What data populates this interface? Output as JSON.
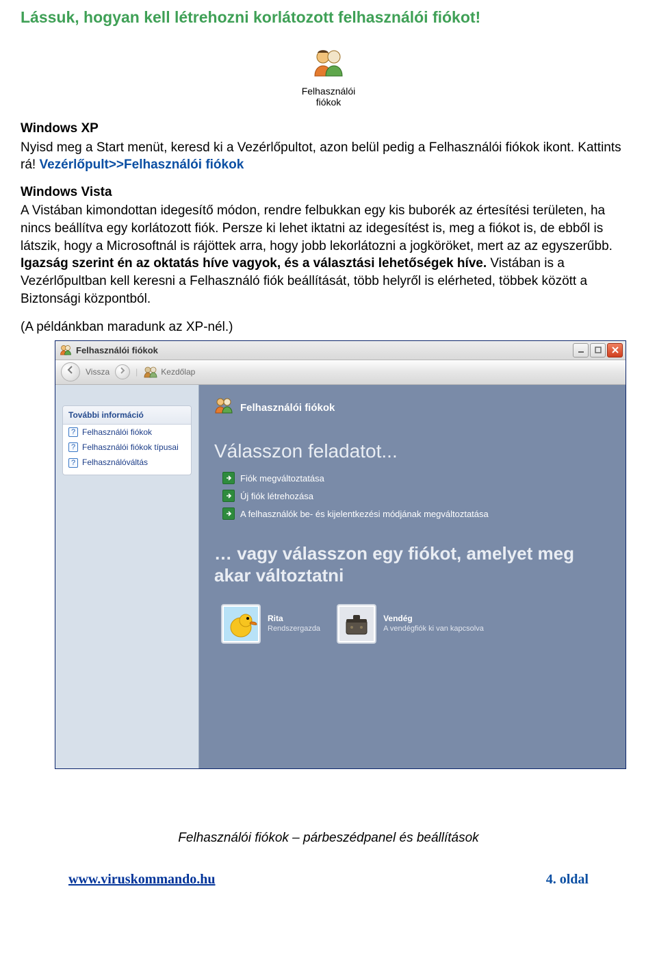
{
  "heading": "Lássuk, hogyan kell létrehozni korlátozott felhasználói fiókot!",
  "center_icon_caption_l1": "Felhasználói",
  "center_icon_caption_l2": "fiókok",
  "xp_heading": "Windows XP",
  "xp_text_pre": "Nyisd meg a Start menüt, keresd ki a Vezérlőpultot, azon belül pedig a Felhasználói fiókok ikont. Kattints rá!",
  "xp_link": "Vezérlőpult>>Felhasználói fiókok",
  "vista_heading": "Windows Vista",
  "vista_para_a": "A Vistában kimondottan idegesítő módon, rendre felbukkan egy kis buborék az értesítési területen, ha nincs  beállítva egy korlátozott fiók. Persze ki lehet iktatni az idegesítést is, meg a fiókot is, de ebből is látszik, hogy a Microsoftnál is rájöttek arra, hogy jobb lekorlátozni a jogköröket, mert az az egyszerűbb. ",
  "vista_bold": "Igazság szerint én az oktatás híve vagyok, és a választási lehetőségek híve.",
  "vista_para_b": " Vistában is a Vezérlőpultban kell keresni a Felhasználó fiók beállítását, több helyről is elérheted, többek között a Biztonsági központból.",
  "example_note": "(A példánkban maradunk az XP-nél.)",
  "window": {
    "title": "Felhasználói fiókok",
    "back": "Vissza",
    "home": "Kezdőlap",
    "side_header": "További információ",
    "side_items": [
      "Felhasználói fiókok",
      "Felhasználói fiókok típusai",
      "Felhasználóváltás"
    ],
    "main_label": "Felhasználói fiókok",
    "task_heading": "Válasszon feladatot...",
    "tasks": [
      "Fiók megváltoztatása",
      "Új fiók létrehozása",
      "A felhasználók be- és kijelentkezési módjának megváltoztatása"
    ],
    "or_heading": "… vagy válasszon egy fiókot, amelyet meg akar változtatni",
    "accounts": [
      {
        "name": "Rita",
        "sub": "Rendszergazda"
      },
      {
        "name": "Vendég",
        "sub": "A vendégfiók ki van kapcsolva"
      }
    ]
  },
  "figure_caption": "Felhasználói fiókok – párbeszédpanel és beállítások",
  "site_link": "www.viruskommando.hu",
  "page_number": "4. oldal"
}
